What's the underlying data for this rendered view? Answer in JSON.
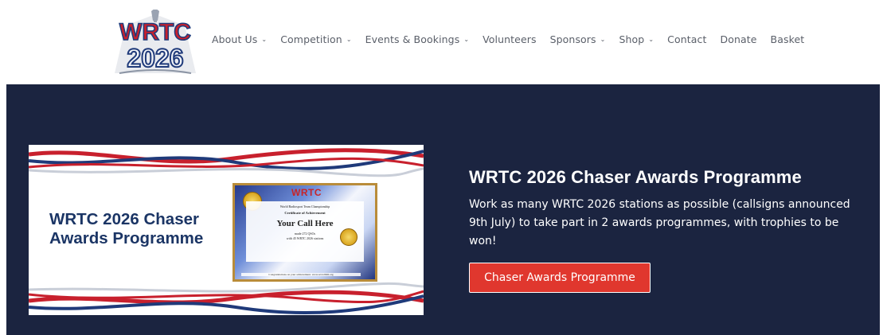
{
  "brand": {
    "logo_text_top": "WRTC",
    "logo_text_bottom": "2026"
  },
  "nav": {
    "items": [
      {
        "label": "About Us",
        "has_dropdown": true
      },
      {
        "label": "Competition",
        "has_dropdown": true
      },
      {
        "label": "Events & Bookings",
        "has_dropdown": true
      },
      {
        "label": "Volunteers",
        "has_dropdown": false
      },
      {
        "label": "Sponsors",
        "has_dropdown": true
      },
      {
        "label": "Shop",
        "has_dropdown": true
      },
      {
        "label": "Contact",
        "has_dropdown": false
      },
      {
        "label": "Donate",
        "has_dropdown": false
      },
      {
        "label": "Basket",
        "has_dropdown": false
      }
    ],
    "dropdown_icon": "chevron-down-icon"
  },
  "hero": {
    "banner": {
      "title": "WRTC 2026 Chaser Awards Programme",
      "certificate": {
        "logo": "WRTC",
        "line1": "World Radiosport Team Championship",
        "line2": "Certificate of Achievement",
        "callsign": "Your Call Here",
        "line4": "made 272 QSOs",
        "line5": "with 45 WRTC 2026 stations",
        "footer": "Congratulations on your achievement. www.wrtc2026.org"
      }
    },
    "title": "WRTC 2026 Chaser Awards Programme",
    "description": "Work as many WRTC 2026 stations as possible (callsigns announced 9th July) to take part in 2 awards programmes, with trophies to be won!",
    "button_label": "Chaser Awards Programme"
  },
  "colors": {
    "hero_background": "#1b2440",
    "button_background": "#e0372e",
    "banner_title": "#1b3565",
    "ribbon_red": "#c8202d",
    "ribbon_blue": "#1f3a7a",
    "nav_text": "#5a5f69"
  }
}
